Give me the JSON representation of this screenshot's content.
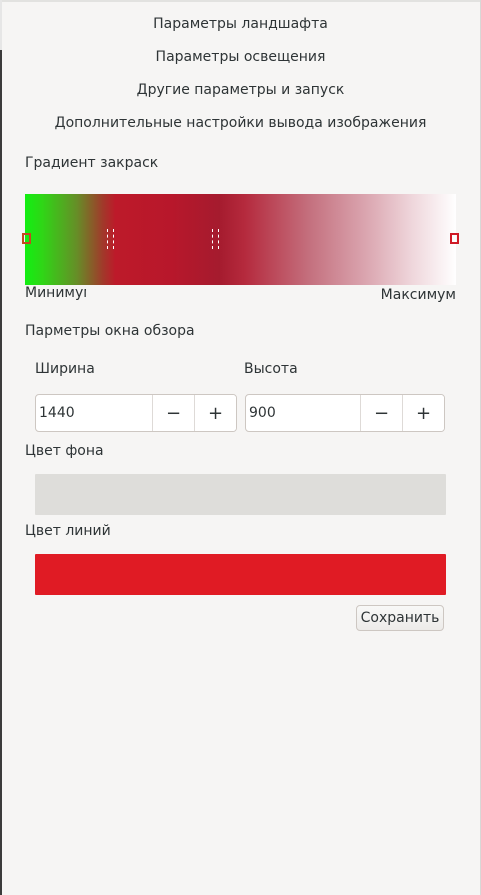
{
  "sections": {
    "landscape": "Параметры ландшафта",
    "lighting": "Параметры освещения",
    "other": "Другие параметры и запуск",
    "output": "Дополнительные настройки вывода изображения"
  },
  "gradient": {
    "title": "Градиент закраск",
    "min_label": "Минимум",
    "max_label": "Максимум"
  },
  "viewport": {
    "title": "Парметры окна обзора",
    "width_label": "Ширина",
    "width_value": "1440",
    "height_label": "Высота",
    "height_value": "900",
    "minus": "−",
    "plus": "+"
  },
  "background": {
    "label": "Цвет фона",
    "color": "#deddda"
  },
  "lines": {
    "label": "Цвет линий",
    "color": "#e01b24"
  },
  "save_label": "Сохранить"
}
